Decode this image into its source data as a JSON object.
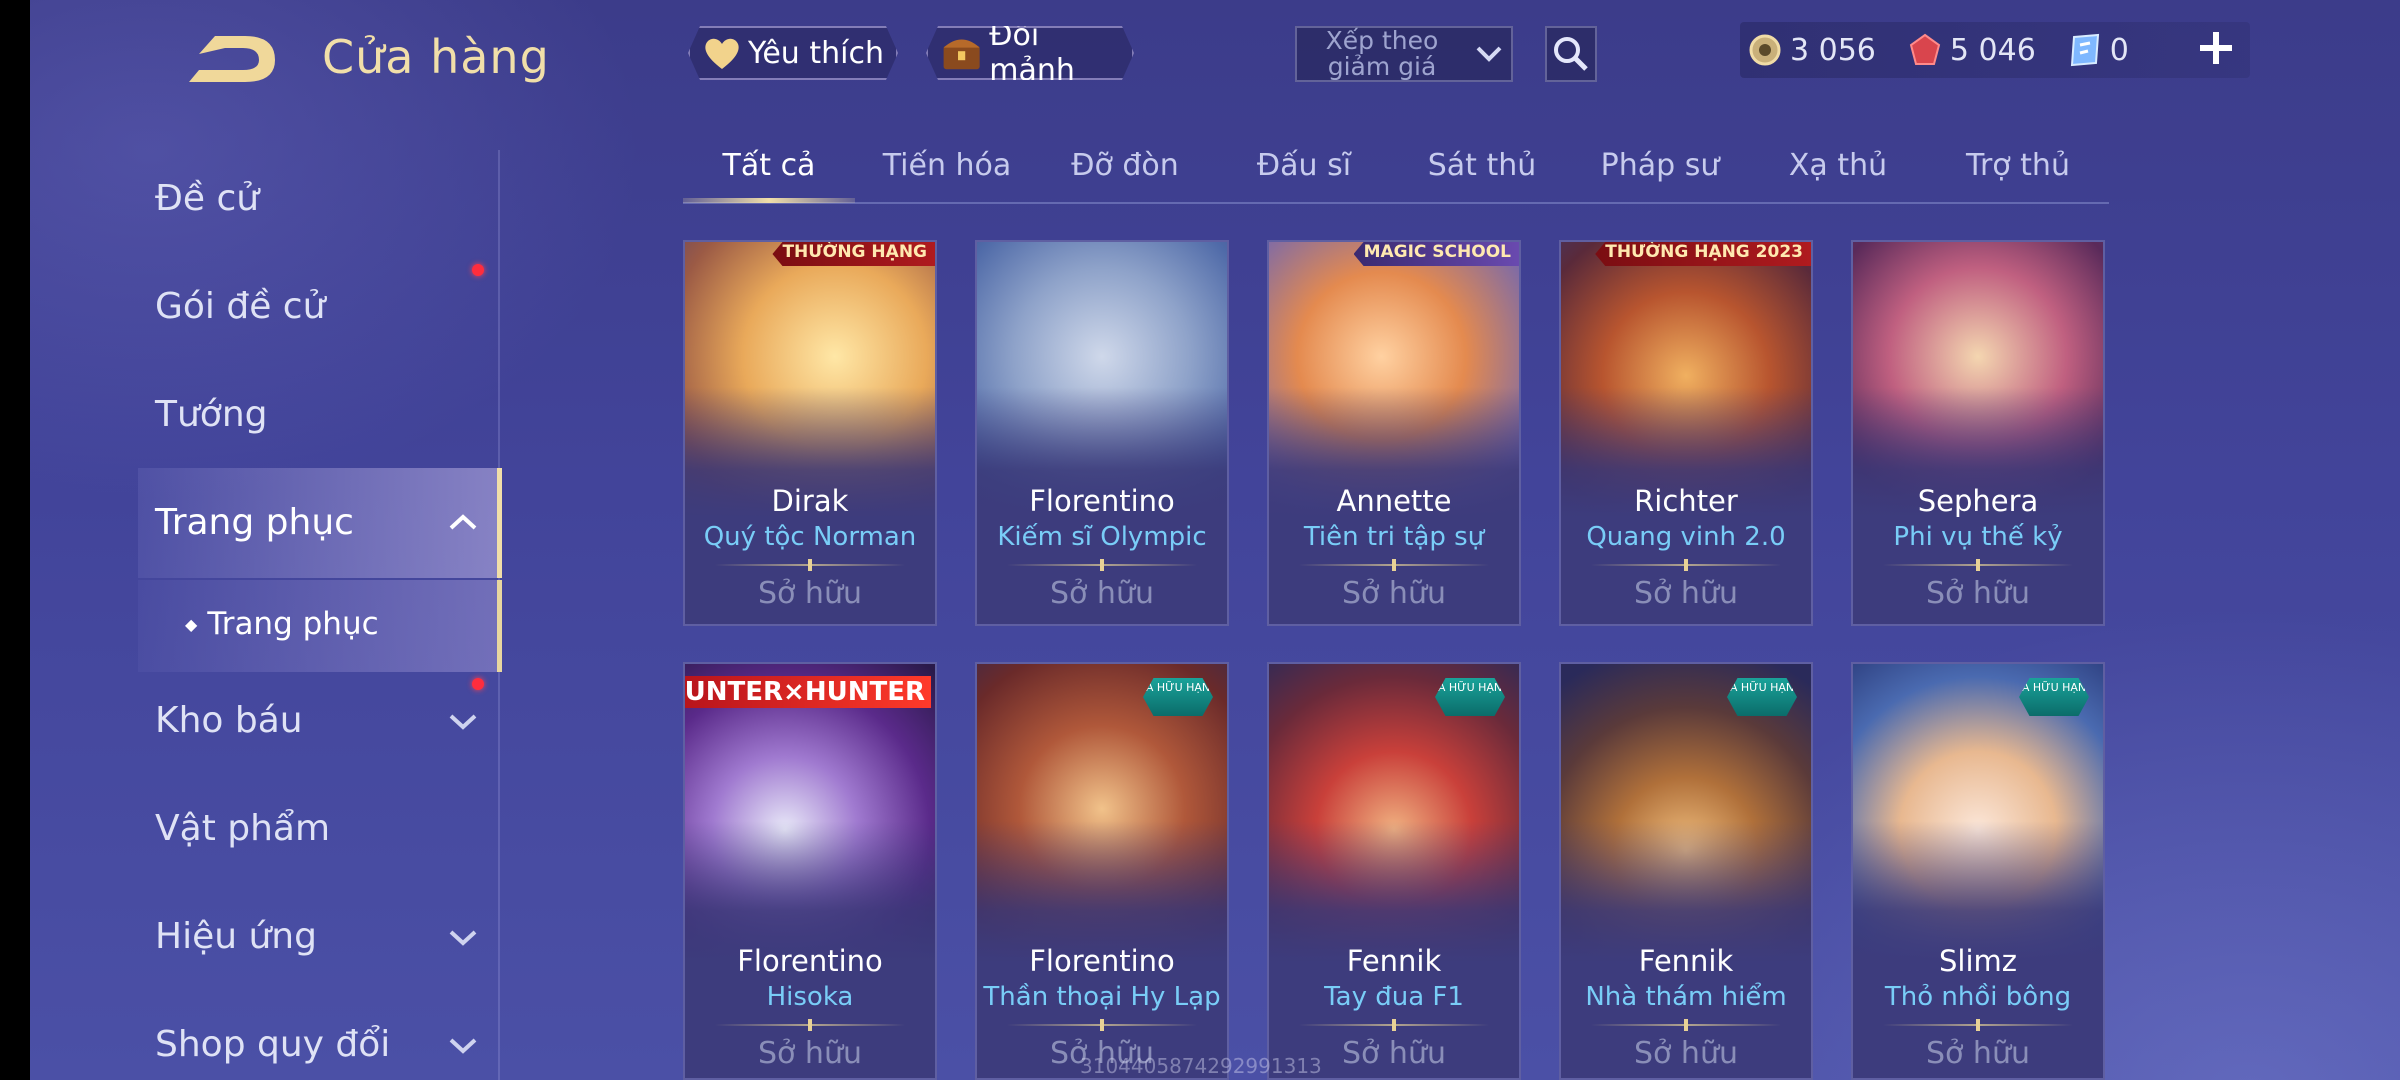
{
  "header": {
    "title": "Cửa hàng",
    "favorites_label": "Yêu thích",
    "fragments_label": "Đổi mảnh",
    "sort_label": "Xếp theo giảm giá",
    "currency": [
      {
        "icon": "gold-coin-icon",
        "value": "3 056"
      },
      {
        "icon": "red-gem-icon",
        "value": "5 046"
      },
      {
        "icon": "voucher-icon",
        "value": "0"
      }
    ]
  },
  "sidebar": {
    "items": [
      {
        "label": "Đề cử"
      },
      {
        "label": "Gói đề cử"
      },
      {
        "label": "Tướng"
      },
      {
        "label": "Trang phục"
      },
      {
        "label": "Trang phục"
      },
      {
        "label": "Kho báu"
      },
      {
        "label": "Vật phẩm"
      },
      {
        "label": "Hiệu ứng"
      },
      {
        "label": "Shop quy đổi"
      }
    ]
  },
  "tabs": [
    "Tất cả",
    "Tiến hóa",
    "Đỡ đòn",
    "Đấu sĩ",
    "Sát thủ",
    "Pháp sư",
    "Xạ thủ",
    "Trợ thủ"
  ],
  "cards": [
    {
      "hero": "Dirak",
      "skin": "Quý tộc Norman",
      "status": "Sở hữu",
      "badge": "THƯỜNG HẠNG"
    },
    {
      "hero": "Florentino",
      "skin": "Kiếm sĩ Olympic",
      "status": "Sở hữu",
      "badge": ""
    },
    {
      "hero": "Annette",
      "skin": "Tiên tri tập sự",
      "status": "Sở hữu",
      "badge": "MAGIC SCHOOL"
    },
    {
      "hero": "Richter",
      "skin": "Quang vinh 2.0",
      "status": "Sở hữu",
      "badge": "THƯỜNG HẠNG 2023"
    },
    {
      "hero": "Sephera",
      "skin": "Phi vụ thế kỷ",
      "status": "Sở hữu",
      "badge": ""
    },
    {
      "hero": "Florentino",
      "skin": "Hisoka",
      "status": "Sở hữu",
      "badge": "HUNTER×HUNTER"
    },
    {
      "hero": "Florentino",
      "skin": "Thần thoại Hy Lạp",
      "status": "Sở hữu",
      "badge": "A HỮU HẠN"
    },
    {
      "hero": "Fennik",
      "skin": "Tay đua F1",
      "status": "Sở hữu",
      "badge": "A HỮU HẠN"
    },
    {
      "hero": "Fennik",
      "skin": "Nhà thám hiểm",
      "status": "Sở hữu",
      "badge": "A HỮU HẠN"
    },
    {
      "hero": "Slimz",
      "skin": "Thỏ nhồi bông",
      "status": "Sở hữu",
      "badge": "A HỮU HẠN"
    }
  ],
  "watermark": "3104405874292991313",
  "colors": {
    "accent_gold": "#f1dfa9",
    "skin_name": "#79cdf7",
    "notification": "#ff2d3d"
  }
}
